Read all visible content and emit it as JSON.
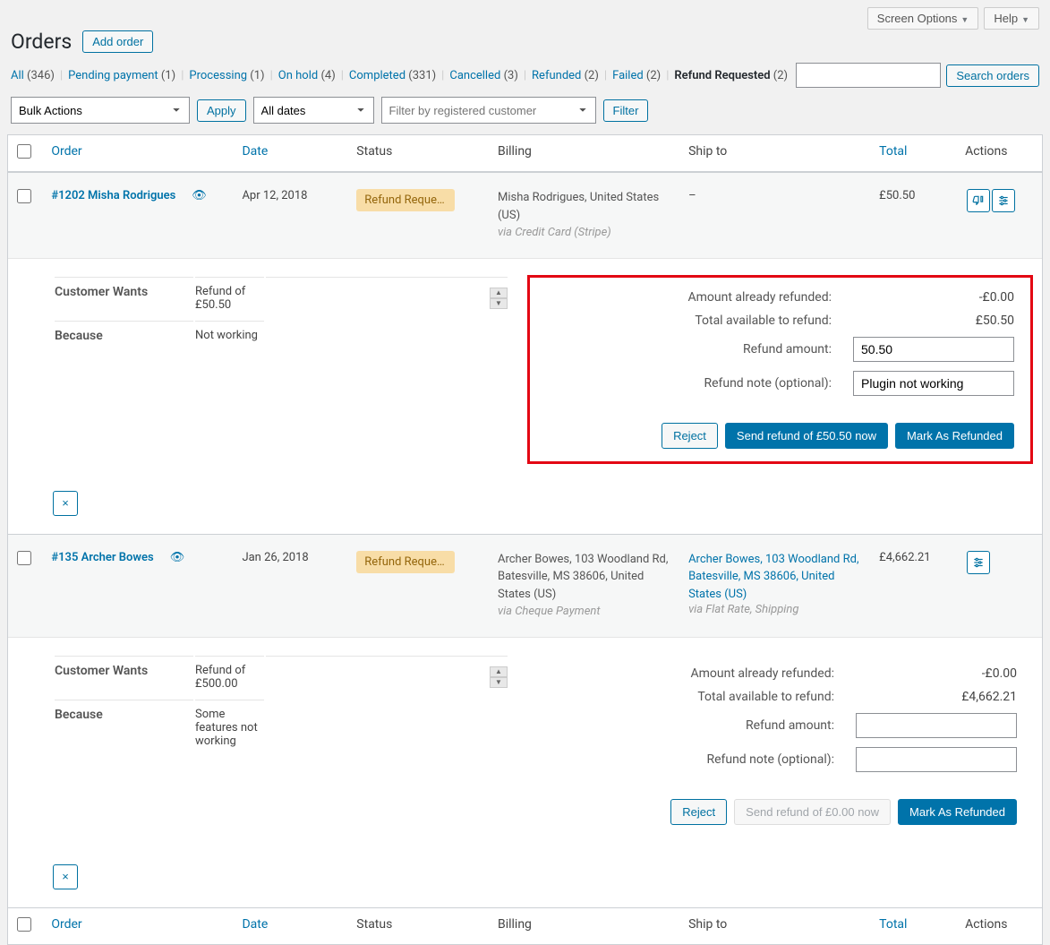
{
  "topbar": {
    "screen_options": "Screen Options",
    "help": "Help"
  },
  "page": {
    "title": "Orders",
    "add_btn": "Add order"
  },
  "filters_tabs": [
    {
      "label": "All",
      "count": "(346)",
      "current": false
    },
    {
      "label": "Pending payment",
      "count": "(1)",
      "current": false
    },
    {
      "label": "Processing",
      "count": "(1)",
      "current": false
    },
    {
      "label": "On hold",
      "count": "(4)",
      "current": false
    },
    {
      "label": "Completed",
      "count": "(331)",
      "current": false
    },
    {
      "label": "Cancelled",
      "count": "(3)",
      "current": false
    },
    {
      "label": "Refunded",
      "count": "(2)",
      "current": false
    },
    {
      "label": "Failed",
      "count": "(2)",
      "current": false
    },
    {
      "label": "Refund Requested",
      "count": "(2)",
      "current": true
    }
  ],
  "search_btn": "Search orders",
  "bulk": {
    "action": "Bulk Actions",
    "apply": "Apply",
    "dates": "All dates",
    "cust_placeholder": "Filter by registered customer",
    "filter": "Filter"
  },
  "cols": {
    "order": "Order",
    "date": "Date",
    "status": "Status",
    "billing": "Billing",
    "shipto": "Ship to",
    "total": "Total",
    "actions": "Actions"
  },
  "orders": [
    {
      "id": "#1202 Misha Rodrigues",
      "date": "Apr 12, 2018",
      "status": "Refund Reques...",
      "billing_line": "Misha Rodrigues, United States (US)",
      "billing_via": "via Credit Card (Stripe)",
      "ship": "–",
      "ship_via": "",
      "ship_link": false,
      "total": "£50.50",
      "show_thumbsdown": true,
      "highlight_panel": true,
      "wants": "Refund of £50.50",
      "because": "Not working",
      "refund": {
        "already_label": "Amount already refunded:",
        "already_val": "-£0.00",
        "avail_label": "Total available to refund:",
        "avail_val": "£50.50",
        "amount_label": "Refund amount:",
        "amount_val": "50.50",
        "note_label": "Refund note (optional):",
        "note_val": "Plugin not working",
        "reject": "Reject",
        "send": "Send refund of £50.50 now",
        "send_enabled": true,
        "mark": "Mark As Refunded"
      }
    },
    {
      "id": "#135 Archer Bowes",
      "date": "Jan 26, 2018",
      "status": "Refund Reques...",
      "billing_line": "Archer Bowes, 103 Woodland Rd, Batesville, MS 38606, United States (US)",
      "billing_via": "via Cheque Payment",
      "ship": "Archer Bowes, 103 Woodland Rd, Batesville, MS 38606, United States (US)",
      "ship_via": "via Flat Rate, Shipping",
      "ship_link": true,
      "total": "£4,662.21",
      "show_thumbsdown": false,
      "highlight_panel": false,
      "wants": "Refund of £500.00",
      "because": "Some features not working",
      "refund": {
        "already_label": "Amount already refunded:",
        "already_val": "-£0.00",
        "avail_label": "Total available to refund:",
        "avail_val": "£4,662.21",
        "amount_label": "Refund amount:",
        "amount_val": "",
        "note_label": "Refund note (optional):",
        "note_val": "",
        "reject": "Reject",
        "send": "Send refund of £0.00 now",
        "send_enabled": false,
        "mark": "Mark As Refunded"
      }
    }
  ],
  "labels": {
    "cust_wants": "Customer Wants",
    "because": "Because"
  }
}
